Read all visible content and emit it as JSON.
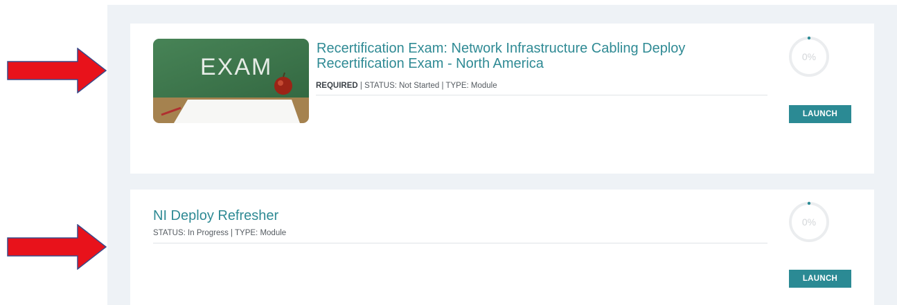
{
  "courses": [
    {
      "title": "Recertification Exam: Network Infrastructure Cabling Deploy Recertification Exam - North America",
      "required_label": "REQUIRED",
      "status_text": " | STATUS: Not Started | TYPE: Module",
      "progress_label": "0%",
      "progress": 0,
      "launch_label": "LAUNCH",
      "thumbnail_text": "EXAM"
    },
    {
      "title": "NI Deploy Refresher",
      "status_text": "STATUS: In Progress | TYPE: Module",
      "progress_label": "0%",
      "progress": 0,
      "launch_label": "LAUNCH"
    }
  ],
  "colors": {
    "accent": "#2b8a94",
    "title": "#2f8a94",
    "arrow": "#e8121b",
    "panel_bg": "#eef2f6"
  }
}
